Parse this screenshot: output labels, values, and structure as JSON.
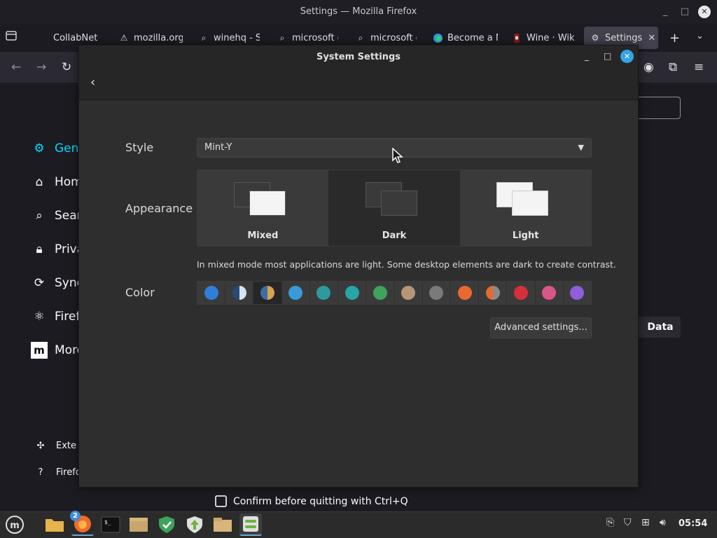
{
  "browser": {
    "window_title": "Settings — Mozilla Firefox",
    "tabs": [
      {
        "label": "CollabNet",
        "icon": "blank-page-icon"
      },
      {
        "label": "mozilla.org,",
        "icon": "warning-icon"
      },
      {
        "label": "winehq - Se",
        "icon": "search-icon"
      },
      {
        "label": "microsoft e",
        "icon": "search-icon"
      },
      {
        "label": "microsoft e",
        "icon": "search-icon"
      },
      {
        "label": "Become a M",
        "icon": "edge-icon"
      },
      {
        "label": "Wine · Wiki",
        "icon": "wine-icon"
      },
      {
        "label": "Settings",
        "icon": "gear-icon"
      }
    ],
    "prefs_nav": [
      "Gene",
      "Hom",
      "Sear",
      "Priva",
      "Sync",
      "Firef",
      "More"
    ],
    "prefs_footer": [
      "Exte",
      "Firefo"
    ],
    "data_button_label": "Data",
    "confirm_quit_label": "Confirm before quitting with Ctrl+Q"
  },
  "dialog": {
    "title": "System Settings",
    "style_label": "Style",
    "style_value": "Mint-Y",
    "appearance_label": "Appearance",
    "appearance_options": [
      {
        "label": "Mixed",
        "selected": false
      },
      {
        "label": "Dark",
        "selected": true
      },
      {
        "label": "Light",
        "selected": false
      }
    ],
    "appearance_hint": "In mixed mode most applications are light. Some desktop elements are dark to create contrast.",
    "color_label": "Color",
    "colors": [
      "#2f7fd9",
      "#6c8fb8",
      "#d8a34a",
      "#3a9ad9",
      "#2f9a9e",
      "#26a6a6",
      "#3fa35b",
      "#b59478",
      "#7a7a7a",
      "#e8692f",
      "#d9784a",
      "#d62f3c",
      "#d9558c",
      "#8e5fd9"
    ],
    "selected_color_index": 2,
    "advanced_button": "Advanced settings..."
  },
  "taskbar": {
    "clock": "05:54",
    "badge_count": "2"
  }
}
